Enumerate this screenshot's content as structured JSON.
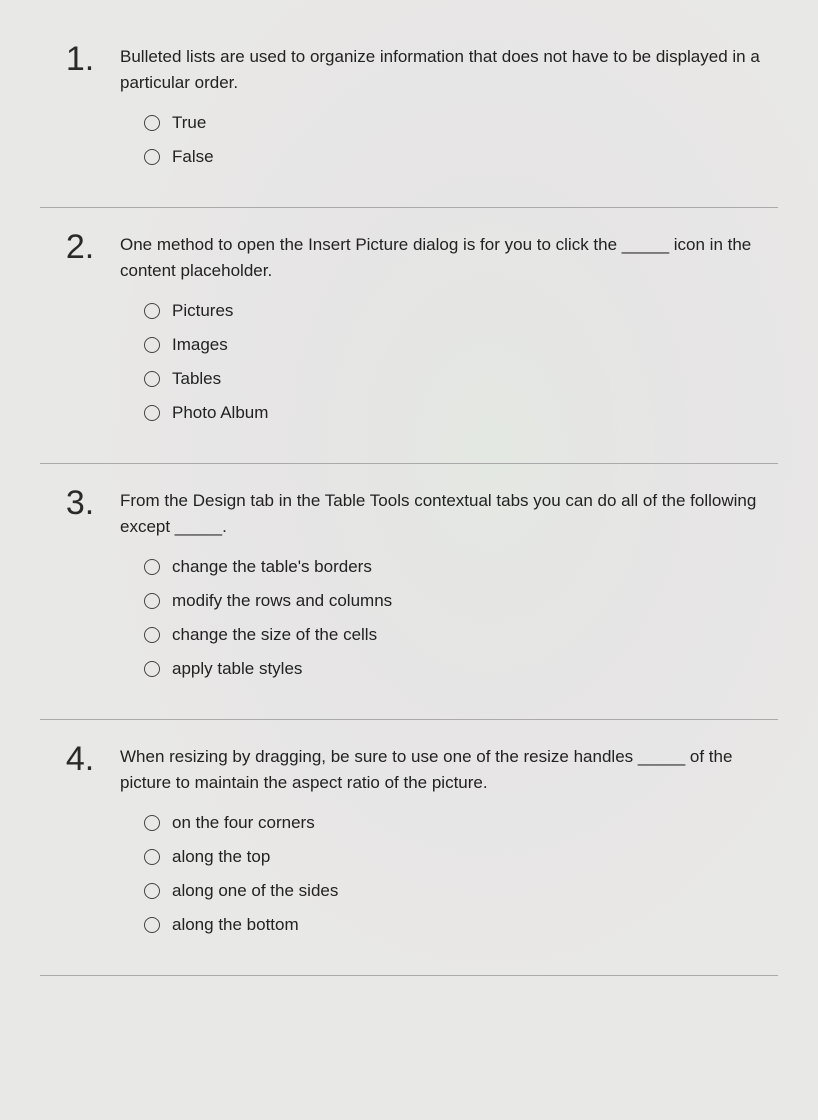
{
  "questions": [
    {
      "number": "1.",
      "prompt": "Bulleted lists are used to organize information that does not have to be displayed in a particular order.",
      "options": [
        "True",
        "False"
      ]
    },
    {
      "number": "2.",
      "prompt": "One method to open the Insert Picture dialog is for you to click the _____ icon in the content placeholder.",
      "options": [
        "Pictures",
        "Images",
        "Tables",
        "Photo Album"
      ]
    },
    {
      "number": "3.",
      "prompt": "From the Design tab in the Table Tools contextual tabs you can do all of the following except _____.",
      "options": [
        "change the table's borders",
        "modify the rows and columns",
        "change the size of the cells",
        "apply table styles"
      ]
    },
    {
      "number": "4.",
      "prompt": "When resizing by dragging, be sure to use one of the resize handles _____ of the picture to maintain the aspect ratio of the picture.",
      "options": [
        "on the four corners",
        "along the top",
        "along one of the sides",
        "along the bottom"
      ]
    }
  ]
}
